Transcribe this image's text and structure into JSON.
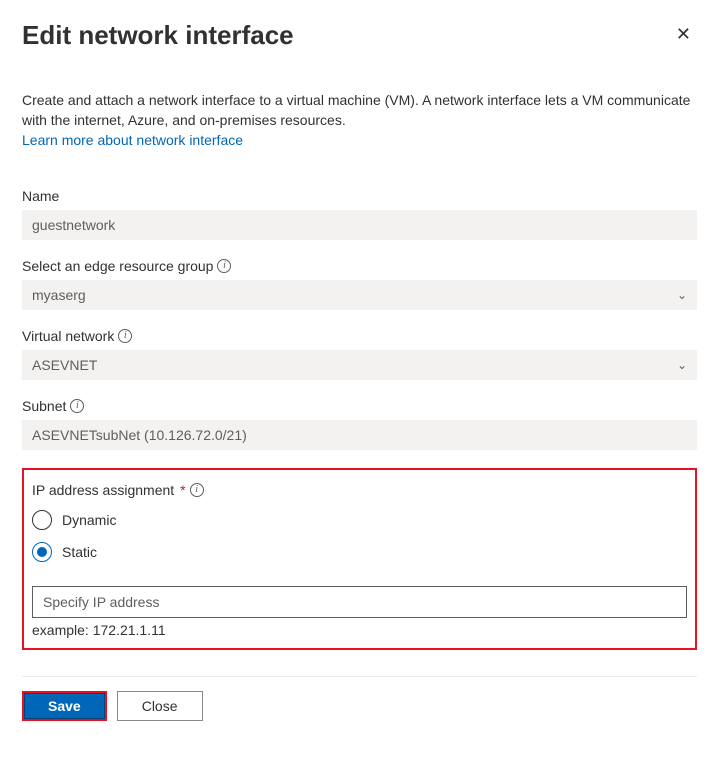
{
  "header": {
    "title": "Edit network interface"
  },
  "description": "Create and attach a network interface to a virtual machine (VM). A network interface lets a VM communicate with the internet, Azure, and on-premises resources.",
  "link": "Learn more about network interface",
  "fields": {
    "name": {
      "label": "Name",
      "value": "guestnetwork"
    },
    "resource_group": {
      "label": "Select an edge resource group",
      "value": "myaserg"
    },
    "vnet": {
      "label": "Virtual network",
      "value": "ASEVNET"
    },
    "subnet": {
      "label": "Subnet",
      "value": "ASEVNETsubNet (10.126.72.0/21)"
    },
    "ip_assignment": {
      "label": "IP address assignment",
      "options": [
        "Dynamic",
        "Static"
      ],
      "selected": "Static",
      "ip_placeholder": "Specify IP address",
      "example": "example: 172.21.1.11"
    }
  },
  "footer": {
    "save": "Save",
    "close": "Close"
  }
}
